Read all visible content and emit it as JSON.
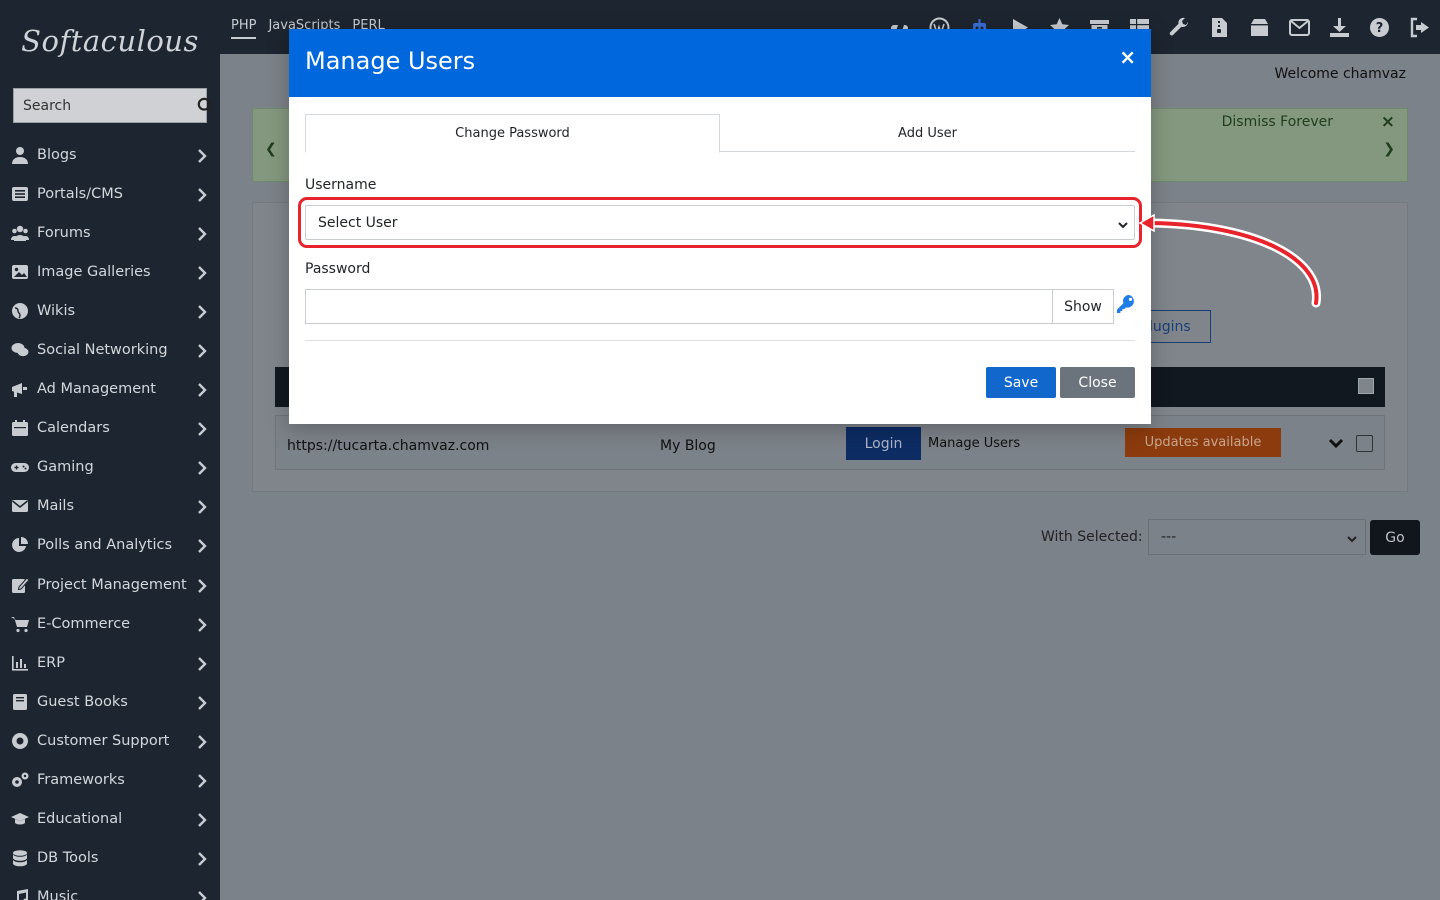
{
  "app": {
    "logo_text": "Softaculous"
  },
  "sidebar": {
    "search_placeholder": "Search",
    "items": [
      {
        "label": "Blogs",
        "icon": "user-icon"
      },
      {
        "label": "Portals/CMS",
        "icon": "list-icon"
      },
      {
        "label": "Forums",
        "icon": "users-icon"
      },
      {
        "label": "Image Galleries",
        "icon": "image-icon"
      },
      {
        "label": "Wikis",
        "icon": "globe-icon"
      },
      {
        "label": "Social Networking",
        "icon": "comments-icon"
      },
      {
        "label": "Ad Management",
        "icon": "bullhorn-icon"
      },
      {
        "label": "Calendars",
        "icon": "calendar-icon"
      },
      {
        "label": "Gaming",
        "icon": "gamepad-icon"
      },
      {
        "label": "Mails",
        "icon": "envelope-icon"
      },
      {
        "label": "Polls and Analytics",
        "icon": "pie-chart-icon"
      },
      {
        "label": "Project Management",
        "icon": "edit-icon"
      },
      {
        "label": "E-Commerce",
        "icon": "cart-icon"
      },
      {
        "label": "ERP",
        "icon": "bar-chart-icon"
      },
      {
        "label": "Guest Books",
        "icon": "book-icon"
      },
      {
        "label": "Customer Support",
        "icon": "life-ring-icon"
      },
      {
        "label": "Frameworks",
        "icon": "cogs-icon"
      },
      {
        "label": "Educational",
        "icon": "graduation-cap-icon"
      },
      {
        "label": "DB Tools",
        "icon": "database-icon"
      },
      {
        "label": "Music",
        "icon": "music-icon"
      }
    ]
  },
  "topbar": {
    "lang_tabs": [
      "PHP",
      "JavaScripts",
      "PERL"
    ],
    "icons": [
      "cpanel-icon",
      "wordpress-icon",
      "robot-icon",
      "play-icon",
      "star-icon",
      "archive-icon",
      "grid-icon",
      "wrench-icon",
      "file-zip-icon",
      "box-icon",
      "envelope-icon",
      "download-icon",
      "help-icon",
      "logout-icon"
    ]
  },
  "main": {
    "welcome": "Welcome chamvaz",
    "notice": {
      "dismiss": "Dismiss Forever",
      "close": "×"
    },
    "plugins_button": "lugins",
    "row": {
      "url": "https://tucarta.chamvaz.com",
      "name": "My Blog",
      "login": "Login",
      "manage_users": "Manage Users",
      "updates": "Updates available"
    },
    "with_selected": {
      "label": "With Selected:",
      "value": "---",
      "go": "Go"
    }
  },
  "modal": {
    "title": "Manage Users",
    "close": "×",
    "tabs": [
      "Change Password",
      "Add User"
    ],
    "active_tab": 0,
    "username_label": "Username",
    "username_select": "Select User",
    "password_label": "Password",
    "password_value": "",
    "show_label": "Show",
    "save": "Save",
    "close_button": "Close"
  },
  "colors": {
    "modal_header": "#0167dd",
    "highlight": "#e8232b",
    "save": "#1167cb",
    "close": "#6b747c",
    "sidebar": "#1d2530"
  }
}
